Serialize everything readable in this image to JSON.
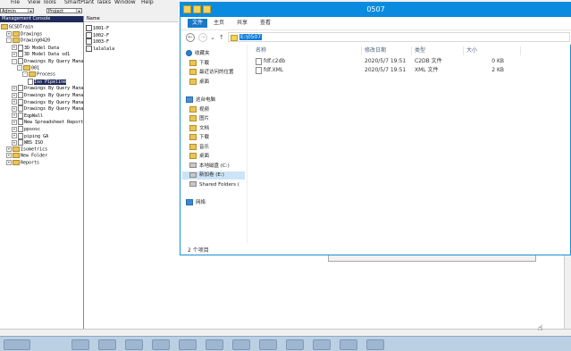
{
  "app": {
    "menu": [
      "File",
      "View",
      "Tools",
      "SmartPlant",
      "Tasks",
      "Window",
      "Help"
    ],
    "combo_left": "Admin",
    "combo_right": "Project",
    "tree_header": "Management Console",
    "tree": [
      {
        "label": "GCSDTrain",
        "indent": 0,
        "icon": "folder",
        "exp": ""
      },
      {
        "label": "Drawings",
        "indent": 1,
        "icon": "folder",
        "exp": "+"
      },
      {
        "label": "Drawing0420",
        "indent": 1,
        "icon": "folder",
        "exp": "-"
      },
      {
        "label": "3D Model Data",
        "indent": 2,
        "icon": "doc",
        "exp": "+"
      },
      {
        "label": "3D Model Data sd1",
        "indent": 2,
        "icon": "doc",
        "exp": "+"
      },
      {
        "label": "Drawings By Query Mana",
        "indent": 2,
        "icon": "doc",
        "exp": "-"
      },
      {
        "label": "001",
        "indent": 3,
        "icon": "folder",
        "exp": "-"
      },
      {
        "label": "Process",
        "indent": 4,
        "icon": "folder",
        "exp": "-"
      },
      {
        "label": "Iso Pipeline",
        "indent": 5,
        "icon": "doc",
        "exp": "",
        "selected": true
      },
      {
        "label": "Drawings By Query Mana",
        "indent": 2,
        "icon": "doc",
        "exp": "+"
      },
      {
        "label": "Drawings By Query Mana",
        "indent": 2,
        "icon": "doc",
        "exp": "+"
      },
      {
        "label": "Drawings By Query Mana",
        "indent": 2,
        "icon": "doc",
        "exp": "+"
      },
      {
        "label": "Drawings By Query Mana",
        "indent": 2,
        "icon": "doc",
        "exp": "+"
      },
      {
        "label": "EqpWall",
        "indent": 2,
        "icon": "doc",
        "exp": "+"
      },
      {
        "label": "New Spreadsheet Report",
        "indent": 2,
        "icon": "doc",
        "exp": "+"
      },
      {
        "label": "ppsosc",
        "indent": 2,
        "icon": "doc",
        "exp": "+"
      },
      {
        "label": "piping GA",
        "indent": 2,
        "icon": "doc",
        "exp": "+"
      },
      {
        "label": "WBS ISO",
        "indent": 2,
        "icon": "doc",
        "exp": "+"
      },
      {
        "label": "Isometrics",
        "indent": 1,
        "icon": "folder",
        "exp": "+"
      },
      {
        "label": "New Folder",
        "indent": 1,
        "icon": "folder",
        "exp": "+"
      },
      {
        "label": "Reports",
        "indent": 1,
        "icon": "folder",
        "exp": "+"
      }
    ],
    "list_header": "Name",
    "list_items": [
      "1001-F",
      "1002-F",
      "1003-F",
      "lalalala"
    ]
  },
  "explorer": {
    "title": "0507",
    "ribbon_tabs": [
      "文件",
      "主页",
      "共享",
      "查看"
    ],
    "nav_back": "←",
    "nav_forward": "→",
    "nav_recent": "⌄",
    "nav_up": "↑",
    "address": "E:\\0507",
    "nav_items": [
      {
        "label": "收藏夹",
        "icon": "star",
        "indent": 0
      },
      {
        "label": "下载",
        "icon": "folder",
        "indent": 1
      },
      {
        "label": "最近访问的位置",
        "icon": "folder",
        "indent": 1
      },
      {
        "label": "桌面",
        "icon": "folder",
        "indent": 1
      },
      {
        "label": "",
        "icon": "",
        "indent": 0
      },
      {
        "label": "这台电脑",
        "icon": "pc",
        "indent": 0
      },
      {
        "label": "视频",
        "icon": "folder",
        "indent": 1
      },
      {
        "label": "图片",
        "icon": "folder",
        "indent": 1
      },
      {
        "label": "文档",
        "icon": "folder",
        "indent": 1
      },
      {
        "label": "下载",
        "icon": "folder",
        "indent": 1
      },
      {
        "label": "音乐",
        "icon": "folder",
        "indent": 1
      },
      {
        "label": "桌面",
        "icon": "folder",
        "indent": 1
      },
      {
        "label": "本地磁盘 (C:)",
        "icon": "drive",
        "indent": 1
      },
      {
        "label": "新加卷 (E:)",
        "icon": "drive",
        "indent": 1,
        "selected": true
      },
      {
        "label": "Shared Folders (",
        "icon": "drive",
        "indent": 1
      },
      {
        "label": "",
        "icon": "",
        "indent": 0
      },
      {
        "label": "网络",
        "icon": "net",
        "indent": 0
      }
    ],
    "columns": [
      "名称",
      "修改日期",
      "类型",
      "大小"
    ],
    "files": [
      {
        "name": "fdf.c2db",
        "date": "2020/5/7 19:51",
        "type": "C2DB 文件",
        "size": "0 KB"
      },
      {
        "name": "fdf.XML",
        "date": "2020/5/7 19:51",
        "type": "XML 文件",
        "size": "2 KB"
      }
    ],
    "status": "2 个项目"
  },
  "taskbar": {
    "buttons": 12
  }
}
